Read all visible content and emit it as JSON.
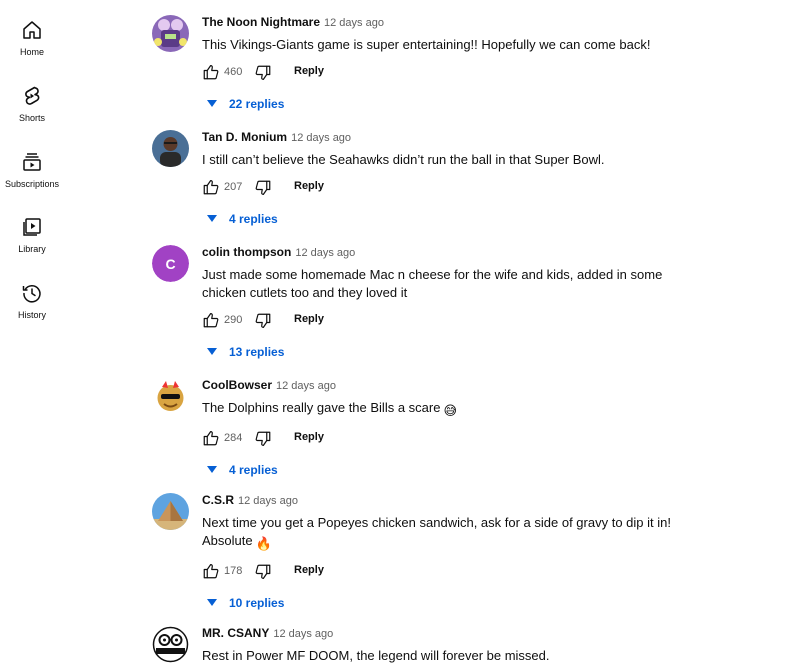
{
  "sidebar": {
    "items": [
      {
        "label": "Home",
        "icon": "home-icon"
      },
      {
        "label": "Shorts",
        "icon": "shorts-icon"
      },
      {
        "label": "Subscriptions",
        "icon": "subscriptions-icon"
      },
      {
        "label": "Library",
        "icon": "library-icon"
      },
      {
        "label": "History",
        "icon": "history-icon"
      }
    ]
  },
  "comments": [
    {
      "author": "The Noon Nightmare",
      "time": "12 days ago",
      "text": "This Vikings-Giants game is super entertaining!! Hopefully we can come back!",
      "likes": "460",
      "reply_label": "Reply",
      "replies_label": "22 replies",
      "avatar": "purple-figure-avatar"
    },
    {
      "author": "Tan D. Monium",
      "time": "12 days ago",
      "text": "I still can’t believe the Seahawks didn’t run the ball in that Super Bowl.",
      "likes": "207",
      "reply_label": "Reply",
      "replies_label": "4 replies",
      "avatar": "photo-avatar"
    },
    {
      "author": "colin thompson",
      "time": "12 days ago",
      "text": "Just made some homemade Mac n cheese for the wife and kids, added in some chicken cutlets too and they loved it",
      "likes": "290",
      "reply_label": "Reply",
      "replies_label": "13 replies",
      "avatar_letter": "C",
      "avatar_color": "#a142c4"
    },
    {
      "author": "CoolBowser",
      "time": "12 days ago",
      "text": "The Dolphins really gave the Bills a scare",
      "emoji": "😅",
      "likes": "284",
      "reply_label": "Reply",
      "replies_label": "4 replies",
      "avatar": "bowser-sunglasses-avatar"
    },
    {
      "author": "C.S.R",
      "time": "12 days ago",
      "text": "Next time you get a Popeyes chicken sandwich, ask for a side of gravy to dip it in! Absolute",
      "emoji": "🔥",
      "likes": "178",
      "reply_label": "Reply",
      "replies_label": "10 replies",
      "avatar": "pyramid-avatar"
    },
    {
      "author": "MR. CSANY",
      "time": "12 days ago",
      "text": "Rest in Power MF DOOM, the legend will forever be missed.",
      "avatar": "antiseptic-logo-avatar",
      "avatar_text": "ANTISEPTIC"
    }
  ],
  "colors": {
    "link_blue": "#065fd4",
    "secondary_text": "#606060",
    "primary_text": "#0f0f0f"
  }
}
